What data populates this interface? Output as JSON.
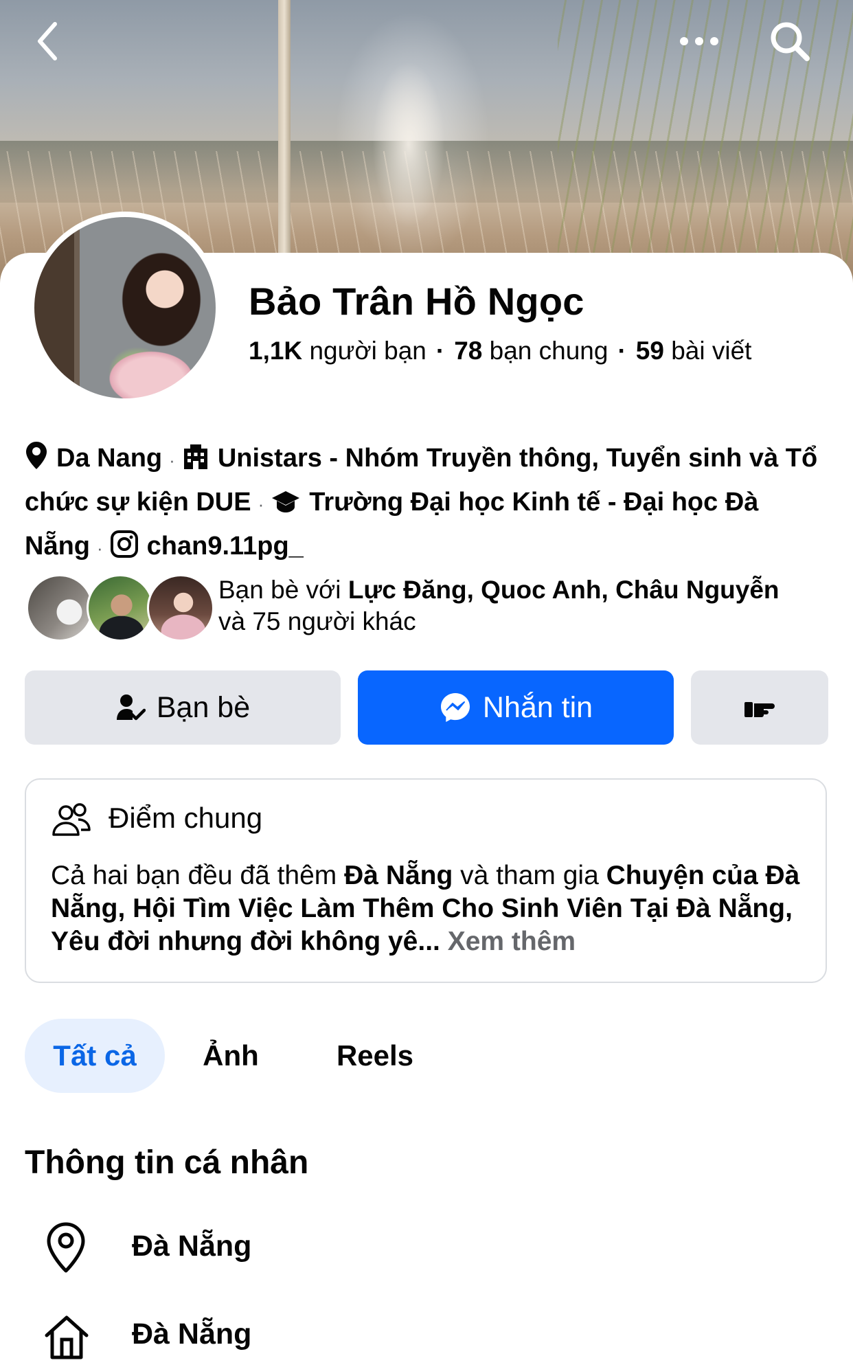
{
  "header": {
    "back_icon": "chevron-left-icon",
    "more_icon": "more-horizontal-icon",
    "search_icon": "search-icon"
  },
  "profile": {
    "name": "Bảo Trân Hồ Ngọc",
    "friends_count": "1,1K",
    "friends_label": "người bạn",
    "mutual_count": "78",
    "mutual_label": "bạn chung",
    "posts_count": "59",
    "posts_label": "bài viết"
  },
  "intro": {
    "location": "Da Nang",
    "work": "Unistars - Nhóm Truyền thông, Tuyển sinh và Tổ chức sự kiện DUE",
    "education": "Trường Đại học Kinh tế - Đại học Đà Nẵng",
    "instagram": "chan9.11pg_"
  },
  "mutual_friends": {
    "prefix": "Bạn bè với ",
    "names": "Lực Đăng, Quoc Anh, Châu Nguyễn",
    "suffix": "và 75 người khác"
  },
  "actions": {
    "friends_label": "Bạn bè",
    "message_label": "Nhắn tin",
    "accent": "#0866ff"
  },
  "common": {
    "title": "Điểm chung",
    "text_a": "Cả hai bạn đều đã thêm ",
    "bold_a": "Đà Nẵng",
    "text_b": " và tham gia ",
    "bold_b": "Chuyện của Đà Nẵng, Hội Tìm Việc Làm Thêm Cho Sinh Viên Tại Đà Nẵng, Yêu đời nhưng đời không yê...",
    "see_more": "Xem thêm"
  },
  "tabs": [
    {
      "label": "Tất cả",
      "active": true
    },
    {
      "label": "Ảnh",
      "active": false
    },
    {
      "label": "Reels",
      "active": false
    }
  ],
  "personal_info": {
    "title": "Thông tin cá nhân",
    "items": [
      {
        "icon": "location-pin-icon",
        "label": "Đà Nẵng"
      },
      {
        "icon": "home-icon",
        "label": "Đà Nẵng"
      }
    ]
  }
}
